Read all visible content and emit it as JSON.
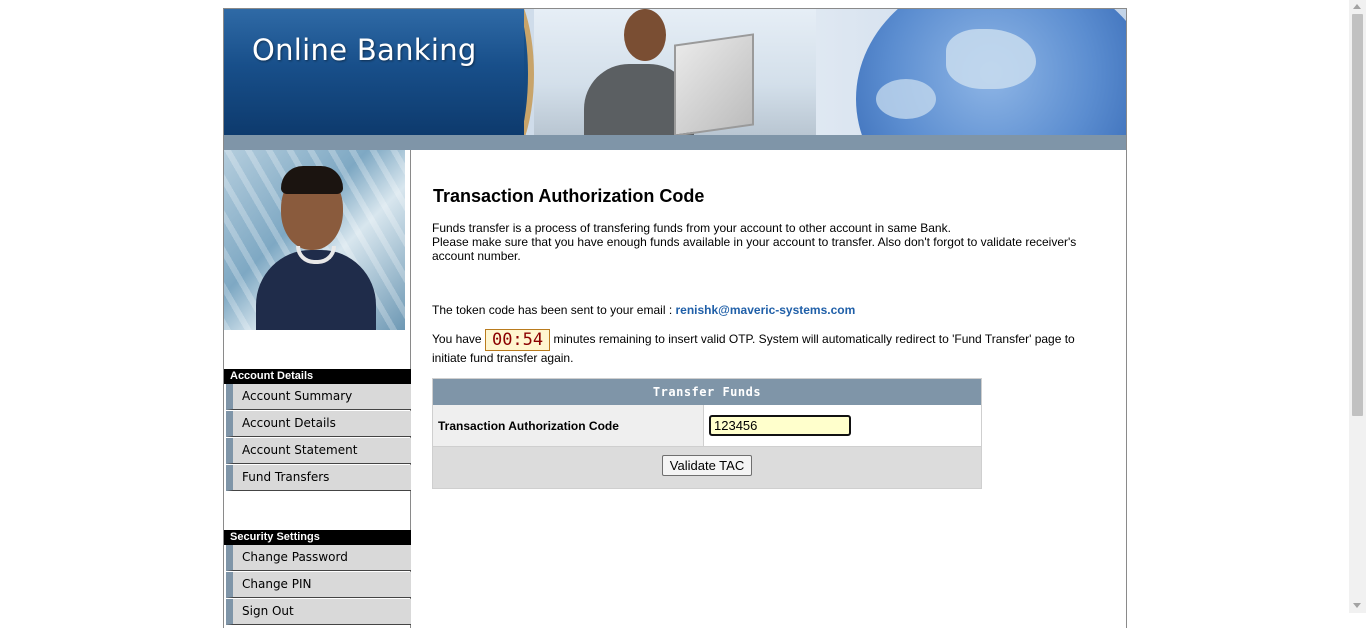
{
  "banner": {
    "title": "Online Banking"
  },
  "sidebar": {
    "sections": [
      {
        "title": "Account Details",
        "items": [
          "Account Summary",
          "Account Details",
          "Account Statement",
          "Fund Transfers"
        ]
      },
      {
        "title": "Security Settings",
        "items": [
          "Change Password",
          "Change PIN",
          "Sign Out"
        ]
      }
    ]
  },
  "main": {
    "title": "Transaction Authorization Code",
    "intro_line1": "Funds transfer is a process of transfering funds from your account to other account in same Bank.",
    "intro_line2": "Please make sure that you have enough funds available in your account to transfer. Also don't forgot to validate receiver's account number.",
    "token_text": "The token code has been sent to your email : ",
    "email": "renishk@maveric-systems.com",
    "timer_prefix": "You have",
    "timer_value": "00:54",
    "timer_suffix": "minutes remaining to insert valid OTP. System will automatically redirect to 'Fund Transfer' page to initiate fund transfer again.",
    "form": {
      "header": "Transfer Funds",
      "field_label": "Transaction Authorization Code",
      "field_value": "123456",
      "button_label": "Validate TAC"
    }
  },
  "colors": {
    "header_bar": "#7f95a8",
    "email_link": "#1f5fa8",
    "input_bg": "#ffffcc",
    "timer_text": "#8b0000"
  }
}
